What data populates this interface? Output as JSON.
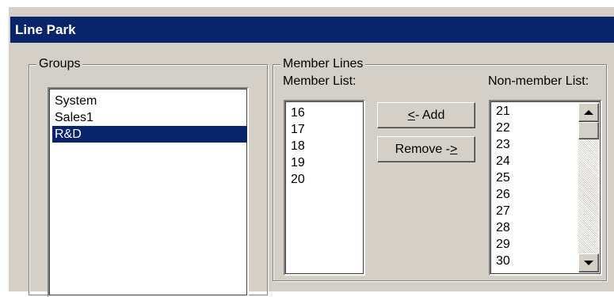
{
  "window": {
    "title": "Line Park"
  },
  "groups": {
    "legend": "Groups",
    "items": [
      "System",
      "Sales1",
      "R&D"
    ],
    "selected": "R&D"
  },
  "member_lines": {
    "legend": "Member Lines",
    "member_label": "Member List:",
    "non_member_label": "Non-member List:",
    "members": [
      "16",
      "17",
      "18",
      "19",
      "20"
    ],
    "non_members": [
      "21",
      "22",
      "23",
      "24",
      "25",
      "26",
      "27",
      "28",
      "29",
      "30"
    ],
    "add_button": {
      "mnemonic": "<",
      "rest": "- Add"
    },
    "remove_button": {
      "prefix": "Remove -",
      "mnemonic": ">"
    }
  },
  "icons": {
    "scroll_up": "arrow-up-icon",
    "scroll_down": "arrow-down-icon"
  },
  "colors": {
    "titlebar": "#0a246a",
    "selection": "#0a246a",
    "face": "#d4d0c8"
  }
}
